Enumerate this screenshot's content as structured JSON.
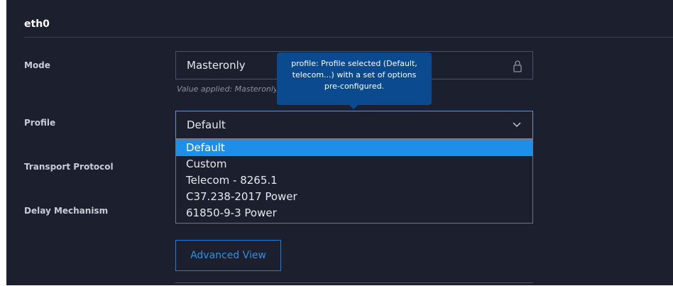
{
  "section": {
    "title": "eth0"
  },
  "rows": {
    "mode": {
      "label": "Mode",
      "value": "Masteronly",
      "helper": "Value applied: Masteronly"
    },
    "profile": {
      "label": "Profile",
      "value": "Default"
    },
    "transport_protocol": {
      "label": "Transport Protocol"
    },
    "delay_mechanism": {
      "label": "Delay Mechanism"
    }
  },
  "tooltip": {
    "text": "profile: Profile selected (Default, telecom...) with a set of options pre-configured."
  },
  "dropdown": {
    "options": [
      {
        "label": "Default",
        "selected": true
      },
      {
        "label": "Custom"
      },
      {
        "label": "Telecom - 8265.1"
      },
      {
        "label": "C37.238-2017 Power"
      },
      {
        "label": "61850-9-3 Power"
      }
    ]
  },
  "advanced_button": {
    "label": "Advanced View"
  },
  "icons": {
    "lock": "lock-icon",
    "chevron": "chevron-down-icon"
  },
  "colors": {
    "background": "#1c202e",
    "accent": "#1e8fe8",
    "tooltip": "#0b4a8f"
  }
}
